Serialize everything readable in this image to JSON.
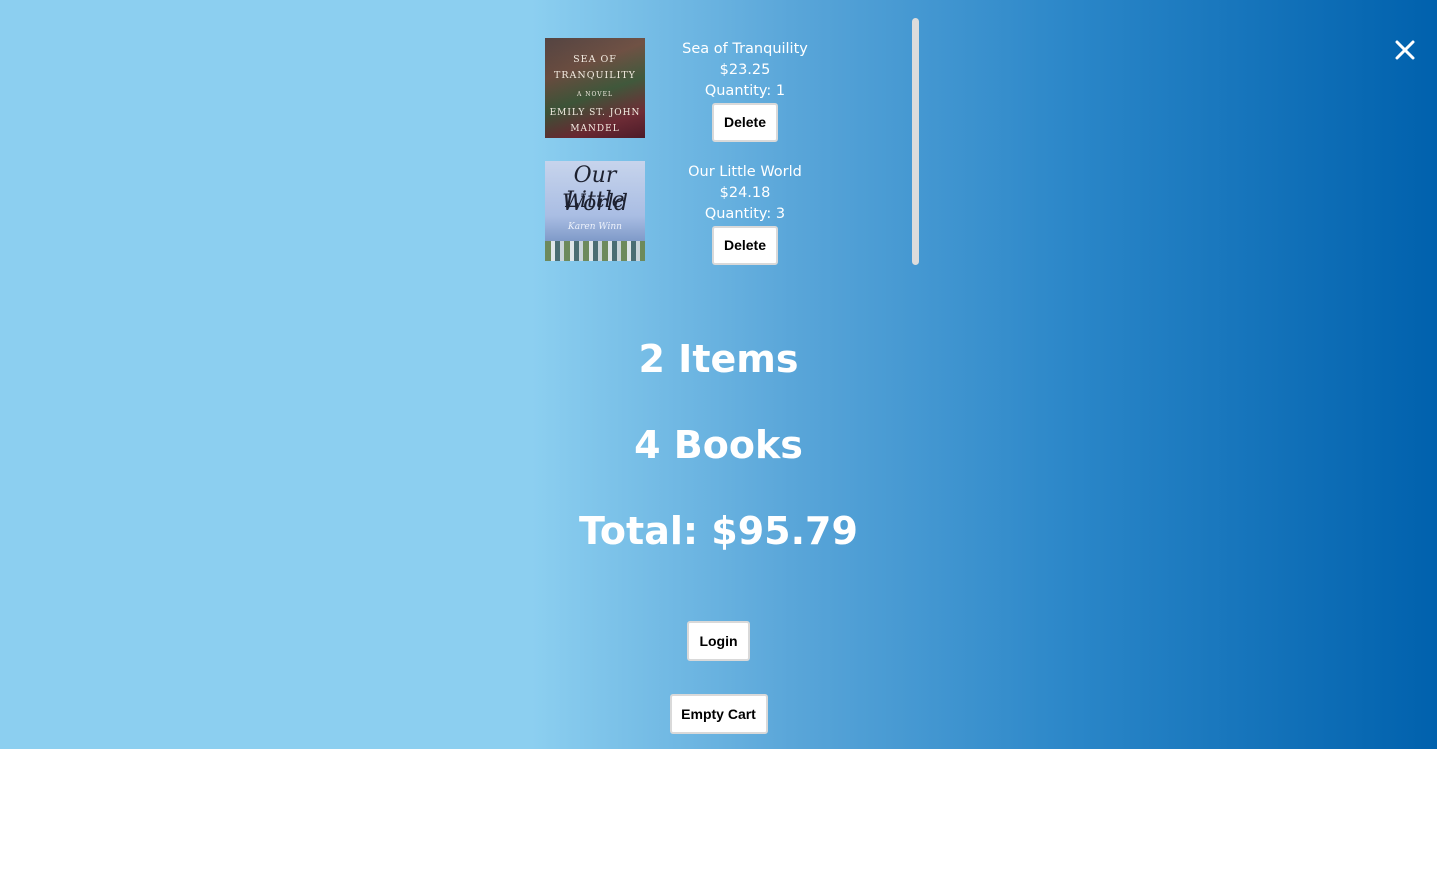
{
  "icons": {
    "close": "close-icon"
  },
  "colors": {
    "gradient_start": "#8ccff0",
    "gradient_end": "#0061ad",
    "text": "#ffffff",
    "button_bg": "#ffffff",
    "button_text": "#000000"
  },
  "cart": {
    "items": [
      {
        "title": "Sea of Tranquility",
        "price": "$23.25",
        "quantity": "Quantity: 1",
        "delete_label": "Delete",
        "cover": {
          "line1": "SEA OF",
          "line2": "TRANQUILITY",
          "line3": "A NOVEL",
          "author1": "EMILY ST. JOHN",
          "author2": "MANDEL"
        }
      },
      {
        "title": "Our Little World",
        "price": "$24.18",
        "quantity": "Quantity: 3",
        "delete_label": "Delete",
        "cover": {
          "line1": "Our Little",
          "line2": "World",
          "author": "Karen Winn"
        }
      }
    ]
  },
  "summary": {
    "items": "2 Items",
    "books": "4 Books",
    "total": "Total: $95.79"
  },
  "actions": {
    "login_label": "Login",
    "empty_cart_label": "Empty Cart"
  }
}
